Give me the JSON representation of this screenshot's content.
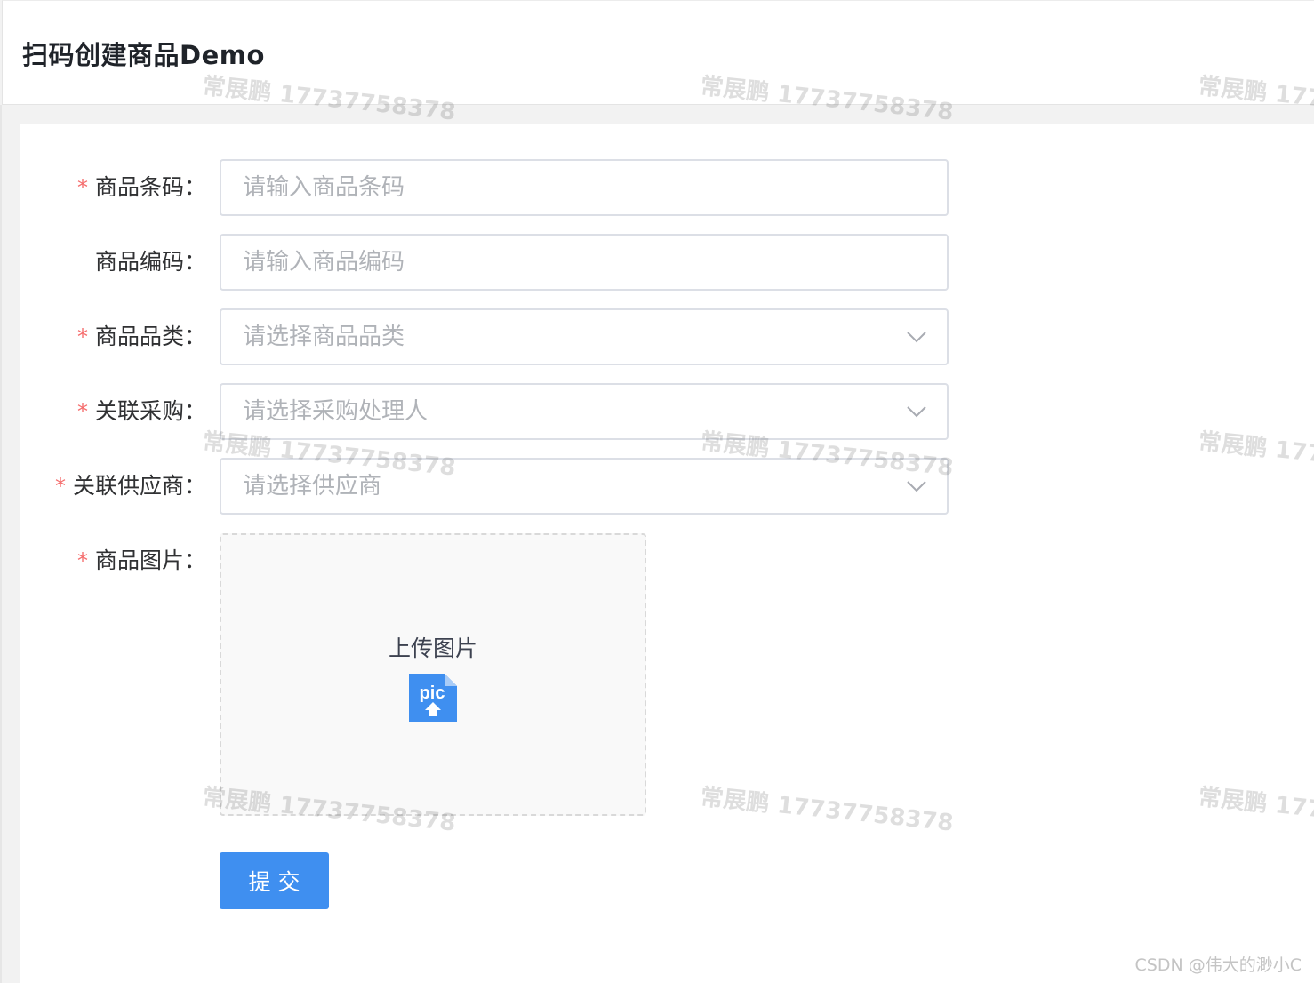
{
  "header": {
    "title": "扫码创建商品Demo"
  },
  "form": {
    "fields": [
      {
        "label": "商品条码：",
        "required": true,
        "placeholder": "请输入商品条码",
        "type": "input"
      },
      {
        "label": "商品编码：",
        "required": false,
        "placeholder": "请输入商品编码",
        "type": "input"
      },
      {
        "label": "商品品类：",
        "required": true,
        "placeholder": "请选择商品品类",
        "type": "select"
      },
      {
        "label": "关联采购：",
        "required": true,
        "placeholder": "请选择采购处理人",
        "type": "select"
      },
      {
        "label": "关联供应商：",
        "required": true,
        "placeholder": "请选择供应商",
        "type": "select"
      }
    ],
    "upload": {
      "label": "商品图片：",
      "required": true,
      "text": "上传图片",
      "icon_text": "pic"
    },
    "required_mark": "*",
    "submit_label": "提交"
  },
  "watermark": {
    "text": "常展鹏 17737758378"
  },
  "credit": "CSDN @伟大的渺小C",
  "colors": {
    "primary": "#3f8ff0",
    "required": "#f56c6c",
    "border": "#dcdfe6",
    "placeholder": "#b0b3b8"
  }
}
